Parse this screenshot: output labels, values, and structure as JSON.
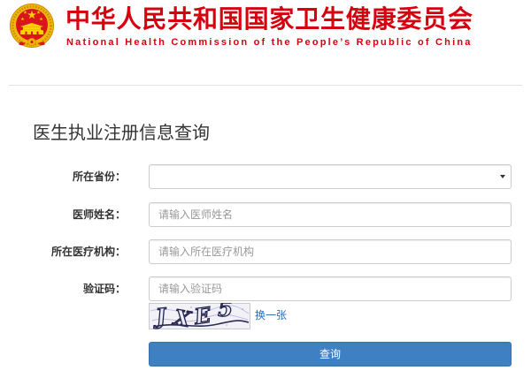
{
  "header": {
    "title_cn": "中华人民共和国国家卫生健康委员会",
    "title_en": "National Health Commission of the People’s Republic of China",
    "emblem_icon": "national-emblem-icon"
  },
  "page": {
    "title": "医生执业注册信息查询"
  },
  "form": {
    "province": {
      "label": "所在省份：",
      "value": "",
      "icon": "caret-down-icon"
    },
    "doctor_name": {
      "label": "医师姓名：",
      "value": "",
      "placeholder": "请输入医师姓名"
    },
    "institution": {
      "label": "所在医疗机构：",
      "value": "",
      "placeholder": "请输入所在医疗机构"
    },
    "captcha": {
      "label": "验证码：",
      "value": "",
      "placeholder": "请输入验证码",
      "text": "JXE5",
      "refresh_label": "换一张"
    },
    "submit_label": "查询"
  },
  "colors": {
    "brand_red": "#d7000f",
    "primary_blue": "#3f80c2",
    "link_blue": "#2d6db2",
    "text_dark": "#333333"
  }
}
